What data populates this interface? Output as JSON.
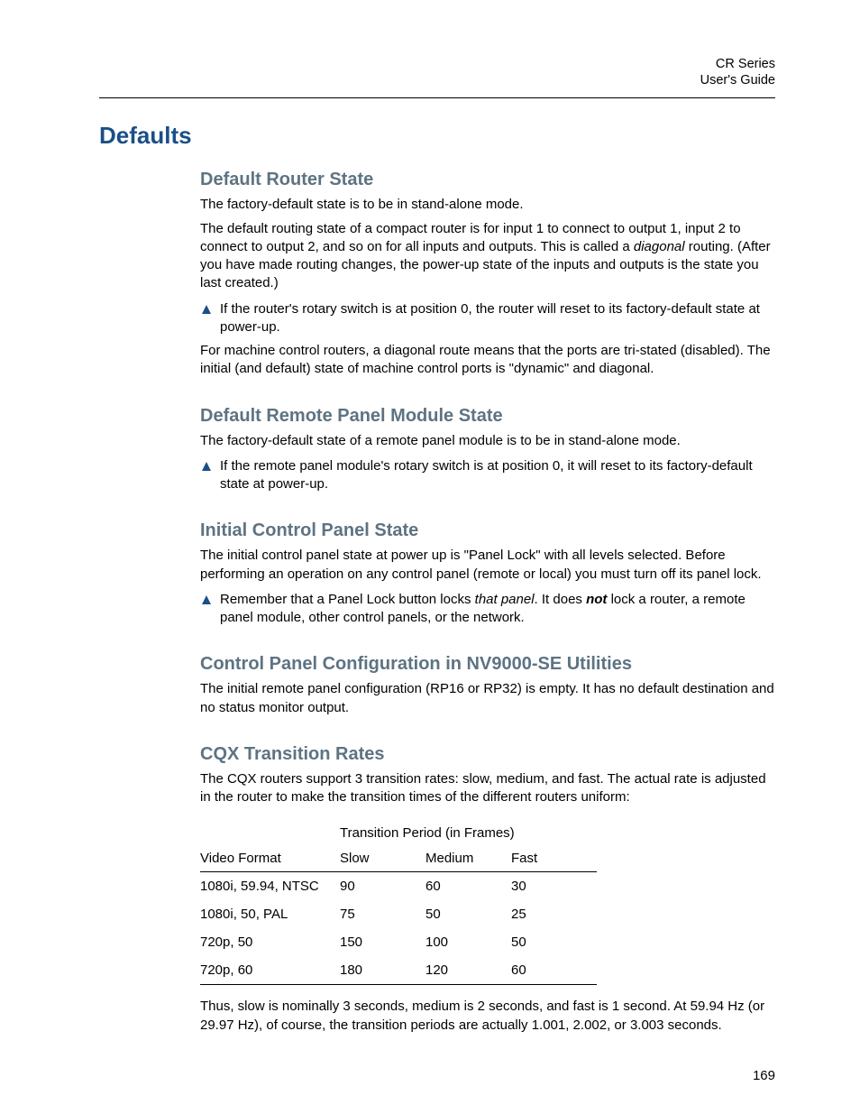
{
  "header": {
    "line1": "CR Series",
    "line2": "User's Guide"
  },
  "chapter_title": "Defaults",
  "sections": {
    "router": {
      "title": "Default Router State",
      "p1": "The factory-default state is to be in stand-alone mode.",
      "p2_a": "The default routing state of a compact router is for input 1 to connect to output 1, input 2 to connect to output 2, and so on for all inputs and outputs. This is called a ",
      "p2_i": "diagonal",
      "p2_b": " routing. (After you have made routing changes, the power-up state of the inputs and outputs is the state you last created.)",
      "note": "If the router's rotary switch is at position 0, the router will reset to its factory-default state at power-up.",
      "p3": "For machine control routers, a diagonal route means that the ports are tri-stated (disabled). The initial (and default) state of machine control ports is \"dynamic\" and diagonal."
    },
    "remote": {
      "title": "Default Remote Panel Module State",
      "p1": "The factory-default state of a remote panel module is to be in stand-alone mode.",
      "note": "If the remote panel module's rotary switch is at position 0, it will reset to its factory-default state at power-up."
    },
    "initial": {
      "title": "Initial Control Panel State",
      "p1": "The initial control panel state at power up is \"Panel Lock\" with all levels selected. Before performing an operation on any control panel (remote or local) you must turn off its panel lock.",
      "note_a": "Remember that a Panel Lock button locks ",
      "note_i": "that panel",
      "note_b": ". It does ",
      "note_bi": "not",
      "note_c": " lock a router, a remote panel module, other control panels, or the network."
    },
    "config": {
      "title": "Control Panel Configuration in NV9000-SE Utilities",
      "p1": "The initial remote panel configuration (RP16 or RP32) is empty. It has no default destination and no status monitor output."
    },
    "cqx": {
      "title": "CQX Transition Rates",
      "p1": "The CQX routers support 3 transition rates: slow, medium, and fast. The actual rate is adjusted in the router to make the transition times of the different routers uniform:",
      "p2": "Thus, slow is nominally 3 seconds, medium is 2 seconds, and fast is 1 second. At 59.94 Hz (or 29.97 Hz), of course, the transition periods are actually 1.001, 2.002, or 3.003 seconds."
    }
  },
  "chart_data": {
    "type": "table",
    "title": "Transition Period (in Frames)",
    "columns": [
      "Video Format",
      "Slow",
      "Medium",
      "Fast"
    ],
    "rows": [
      {
        "format": "1080i, 59.94, NTSC",
        "slow": "90",
        "medium": "60",
        "fast": "30"
      },
      {
        "format": "1080i, 50, PAL",
        "slow": "75",
        "medium": "50",
        "fast": "25"
      },
      {
        "format": "720p, 50",
        "slow": "150",
        "medium": "100",
        "fast": "50"
      },
      {
        "format": "720p, 60",
        "slow": "180",
        "medium": "120",
        "fast": "60"
      }
    ]
  },
  "page_number": "169"
}
